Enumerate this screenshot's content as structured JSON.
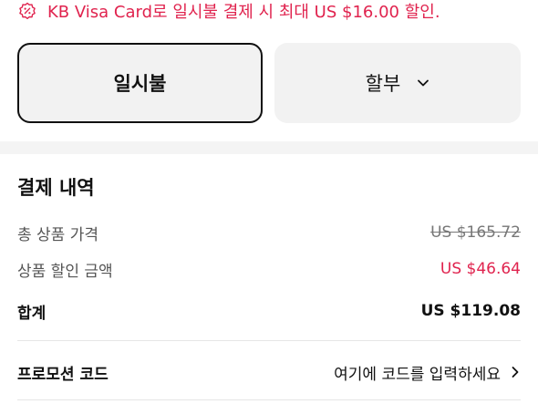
{
  "promo_banner": {
    "icon": "discount-badge-icon",
    "text": "KB Visa Card로 일시불 결제 시 최대 US $16.00 할인.",
    "color": "#e0234e"
  },
  "payment_options": {
    "one_time_label": "일시불",
    "installment_label": "할부",
    "selected": "일시불"
  },
  "summary": {
    "title": "결제 내역",
    "subtotal_label": "총 상품 가격",
    "subtotal_value": "US $165.72",
    "discount_label": "상품 할인 금액",
    "discount_value": "US $46.64",
    "total_label": "합계",
    "total_value": "US $119.08"
  },
  "promo_code": {
    "label": "프로모션 코드",
    "entry_text": "여기에 코드를 입력하세요"
  }
}
